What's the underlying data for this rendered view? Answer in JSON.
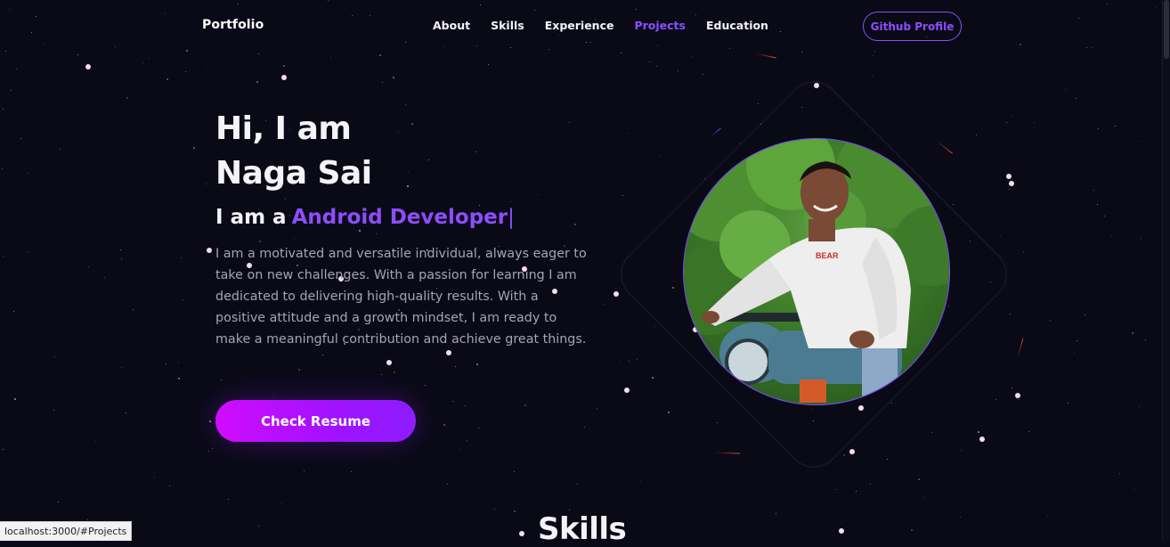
{
  "nav": {
    "brand": "Portfolio",
    "links": [
      "About",
      "Skills",
      "Experience",
      "Projects",
      "Education"
    ],
    "active_link": "Projects",
    "github_label": "Github Profile"
  },
  "hero": {
    "greeting": "Hi, I am",
    "name": "Naga Sai",
    "role_prefix": "I am a",
    "role": "Android Developer",
    "cursor": "|",
    "description": "I am a motivated and versatile individual, always eager to take on new challenges. With a passion for learning I am dedicated to delivering high-quality results. With a positive attitude and a growth mindset, I am ready to make a meaningful contribution and achieve great things.",
    "resume_label": "Check Resume",
    "avatar_shirt_text": "BEAR"
  },
  "skills": {
    "heading": "Skills"
  },
  "status_bar": {
    "url": "localhost:3000/#Projects"
  },
  "colors": {
    "background": "#0a0a17",
    "accent": "#8d4dff",
    "button_gradient_start": "#d10bff",
    "button_gradient_end": "#8f1cff"
  }
}
